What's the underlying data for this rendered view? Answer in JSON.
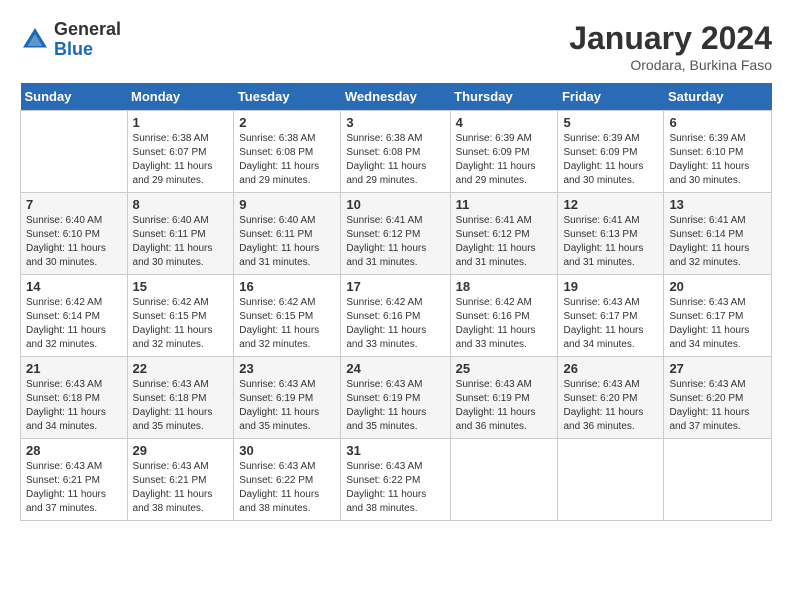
{
  "header": {
    "logo_general": "General",
    "logo_blue": "Blue",
    "month_title": "January 2024",
    "location": "Orodara, Burkina Faso"
  },
  "weekdays": [
    "Sunday",
    "Monday",
    "Tuesday",
    "Wednesday",
    "Thursday",
    "Friday",
    "Saturday"
  ],
  "weeks": [
    [
      {
        "day": "",
        "info": ""
      },
      {
        "day": "1",
        "info": "Sunrise: 6:38 AM\nSunset: 6:07 PM\nDaylight: 11 hours\nand 29 minutes."
      },
      {
        "day": "2",
        "info": "Sunrise: 6:38 AM\nSunset: 6:08 PM\nDaylight: 11 hours\nand 29 minutes."
      },
      {
        "day": "3",
        "info": "Sunrise: 6:38 AM\nSunset: 6:08 PM\nDaylight: 11 hours\nand 29 minutes."
      },
      {
        "day": "4",
        "info": "Sunrise: 6:39 AM\nSunset: 6:09 PM\nDaylight: 11 hours\nand 29 minutes."
      },
      {
        "day": "5",
        "info": "Sunrise: 6:39 AM\nSunset: 6:09 PM\nDaylight: 11 hours\nand 30 minutes."
      },
      {
        "day": "6",
        "info": "Sunrise: 6:39 AM\nSunset: 6:10 PM\nDaylight: 11 hours\nand 30 minutes."
      }
    ],
    [
      {
        "day": "7",
        "info": "Sunrise: 6:40 AM\nSunset: 6:10 PM\nDaylight: 11 hours\nand 30 minutes."
      },
      {
        "day": "8",
        "info": "Sunrise: 6:40 AM\nSunset: 6:11 PM\nDaylight: 11 hours\nand 30 minutes."
      },
      {
        "day": "9",
        "info": "Sunrise: 6:40 AM\nSunset: 6:11 PM\nDaylight: 11 hours\nand 31 minutes."
      },
      {
        "day": "10",
        "info": "Sunrise: 6:41 AM\nSunset: 6:12 PM\nDaylight: 11 hours\nand 31 minutes."
      },
      {
        "day": "11",
        "info": "Sunrise: 6:41 AM\nSunset: 6:12 PM\nDaylight: 11 hours\nand 31 minutes."
      },
      {
        "day": "12",
        "info": "Sunrise: 6:41 AM\nSunset: 6:13 PM\nDaylight: 11 hours\nand 31 minutes."
      },
      {
        "day": "13",
        "info": "Sunrise: 6:41 AM\nSunset: 6:14 PM\nDaylight: 11 hours\nand 32 minutes."
      }
    ],
    [
      {
        "day": "14",
        "info": "Sunrise: 6:42 AM\nSunset: 6:14 PM\nDaylight: 11 hours\nand 32 minutes."
      },
      {
        "day": "15",
        "info": "Sunrise: 6:42 AM\nSunset: 6:15 PM\nDaylight: 11 hours\nand 32 minutes."
      },
      {
        "day": "16",
        "info": "Sunrise: 6:42 AM\nSunset: 6:15 PM\nDaylight: 11 hours\nand 32 minutes."
      },
      {
        "day": "17",
        "info": "Sunrise: 6:42 AM\nSunset: 6:16 PM\nDaylight: 11 hours\nand 33 minutes."
      },
      {
        "day": "18",
        "info": "Sunrise: 6:42 AM\nSunset: 6:16 PM\nDaylight: 11 hours\nand 33 minutes."
      },
      {
        "day": "19",
        "info": "Sunrise: 6:43 AM\nSunset: 6:17 PM\nDaylight: 11 hours\nand 34 minutes."
      },
      {
        "day": "20",
        "info": "Sunrise: 6:43 AM\nSunset: 6:17 PM\nDaylight: 11 hours\nand 34 minutes."
      }
    ],
    [
      {
        "day": "21",
        "info": "Sunrise: 6:43 AM\nSunset: 6:18 PM\nDaylight: 11 hours\nand 34 minutes."
      },
      {
        "day": "22",
        "info": "Sunrise: 6:43 AM\nSunset: 6:18 PM\nDaylight: 11 hours\nand 35 minutes."
      },
      {
        "day": "23",
        "info": "Sunrise: 6:43 AM\nSunset: 6:19 PM\nDaylight: 11 hours\nand 35 minutes."
      },
      {
        "day": "24",
        "info": "Sunrise: 6:43 AM\nSunset: 6:19 PM\nDaylight: 11 hours\nand 35 minutes."
      },
      {
        "day": "25",
        "info": "Sunrise: 6:43 AM\nSunset: 6:19 PM\nDaylight: 11 hours\nand 36 minutes."
      },
      {
        "day": "26",
        "info": "Sunrise: 6:43 AM\nSunset: 6:20 PM\nDaylight: 11 hours\nand 36 minutes."
      },
      {
        "day": "27",
        "info": "Sunrise: 6:43 AM\nSunset: 6:20 PM\nDaylight: 11 hours\nand 37 minutes."
      }
    ],
    [
      {
        "day": "28",
        "info": "Sunrise: 6:43 AM\nSunset: 6:21 PM\nDaylight: 11 hours\nand 37 minutes."
      },
      {
        "day": "29",
        "info": "Sunrise: 6:43 AM\nSunset: 6:21 PM\nDaylight: 11 hours\nand 38 minutes."
      },
      {
        "day": "30",
        "info": "Sunrise: 6:43 AM\nSunset: 6:22 PM\nDaylight: 11 hours\nand 38 minutes."
      },
      {
        "day": "31",
        "info": "Sunrise: 6:43 AM\nSunset: 6:22 PM\nDaylight: 11 hours\nand 38 minutes."
      },
      {
        "day": "",
        "info": ""
      },
      {
        "day": "",
        "info": ""
      },
      {
        "day": "",
        "info": ""
      }
    ]
  ]
}
